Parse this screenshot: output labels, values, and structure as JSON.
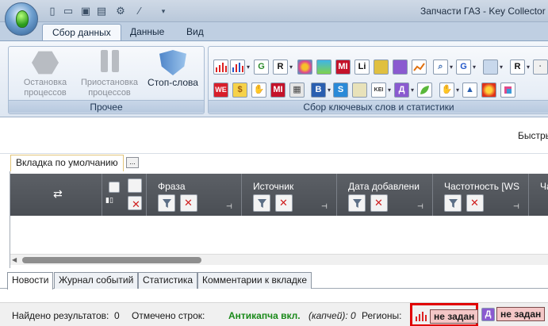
{
  "window": {
    "title": "Запчасти ГАЗ - Key Collector"
  },
  "ribbon_tabs": [
    "Сбор данных",
    "Данные",
    "Вид"
  ],
  "ribbon": {
    "group_other": {
      "label": "Прочее",
      "stop_processes": "Остановка процессов",
      "pause_processes": "Приостановка процессов",
      "stop_words": "Стоп-слова"
    },
    "group_collect": {
      "label": "Сбор ключевых слов и статистики"
    },
    "icon_letters": {
      "g": "G",
      "r": "R",
      "mi": "MI",
      "li": "Li",
      "we": "WE",
      "s": "S",
      "kei": "KEI",
      "b": "B",
      "d": "Д"
    }
  },
  "toolbar": {
    "quick_filter_label": "Быстры"
  },
  "tabs": {
    "default_tab": "Вкладка по умолчанию",
    "menu_glyph": "..."
  },
  "grid": {
    "columns": [
      "Фраза",
      "Источник",
      "Дата добавлени",
      "Частотность [WS",
      "Ча"
    ]
  },
  "bottom_tabs": [
    "Новости",
    "Журнал событий",
    "Статистика",
    "Комментарии к вкладке"
  ],
  "status": {
    "found_label": "Найдено результатов:",
    "found_value": "0",
    "marked_label": "Отмечено строк:",
    "anticaptcha": "Антикапча вкл.",
    "captcha_count": "(капчей): 0",
    "regions_label": "Регионы:",
    "region_1": "не задан",
    "region_2": "не задан",
    "d_icon": "Д"
  },
  "colors": {
    "accent_red": "#e00000",
    "anticaptcha_green": "#1a8a1a",
    "region_badge_bg": "#f4c7c7"
  }
}
